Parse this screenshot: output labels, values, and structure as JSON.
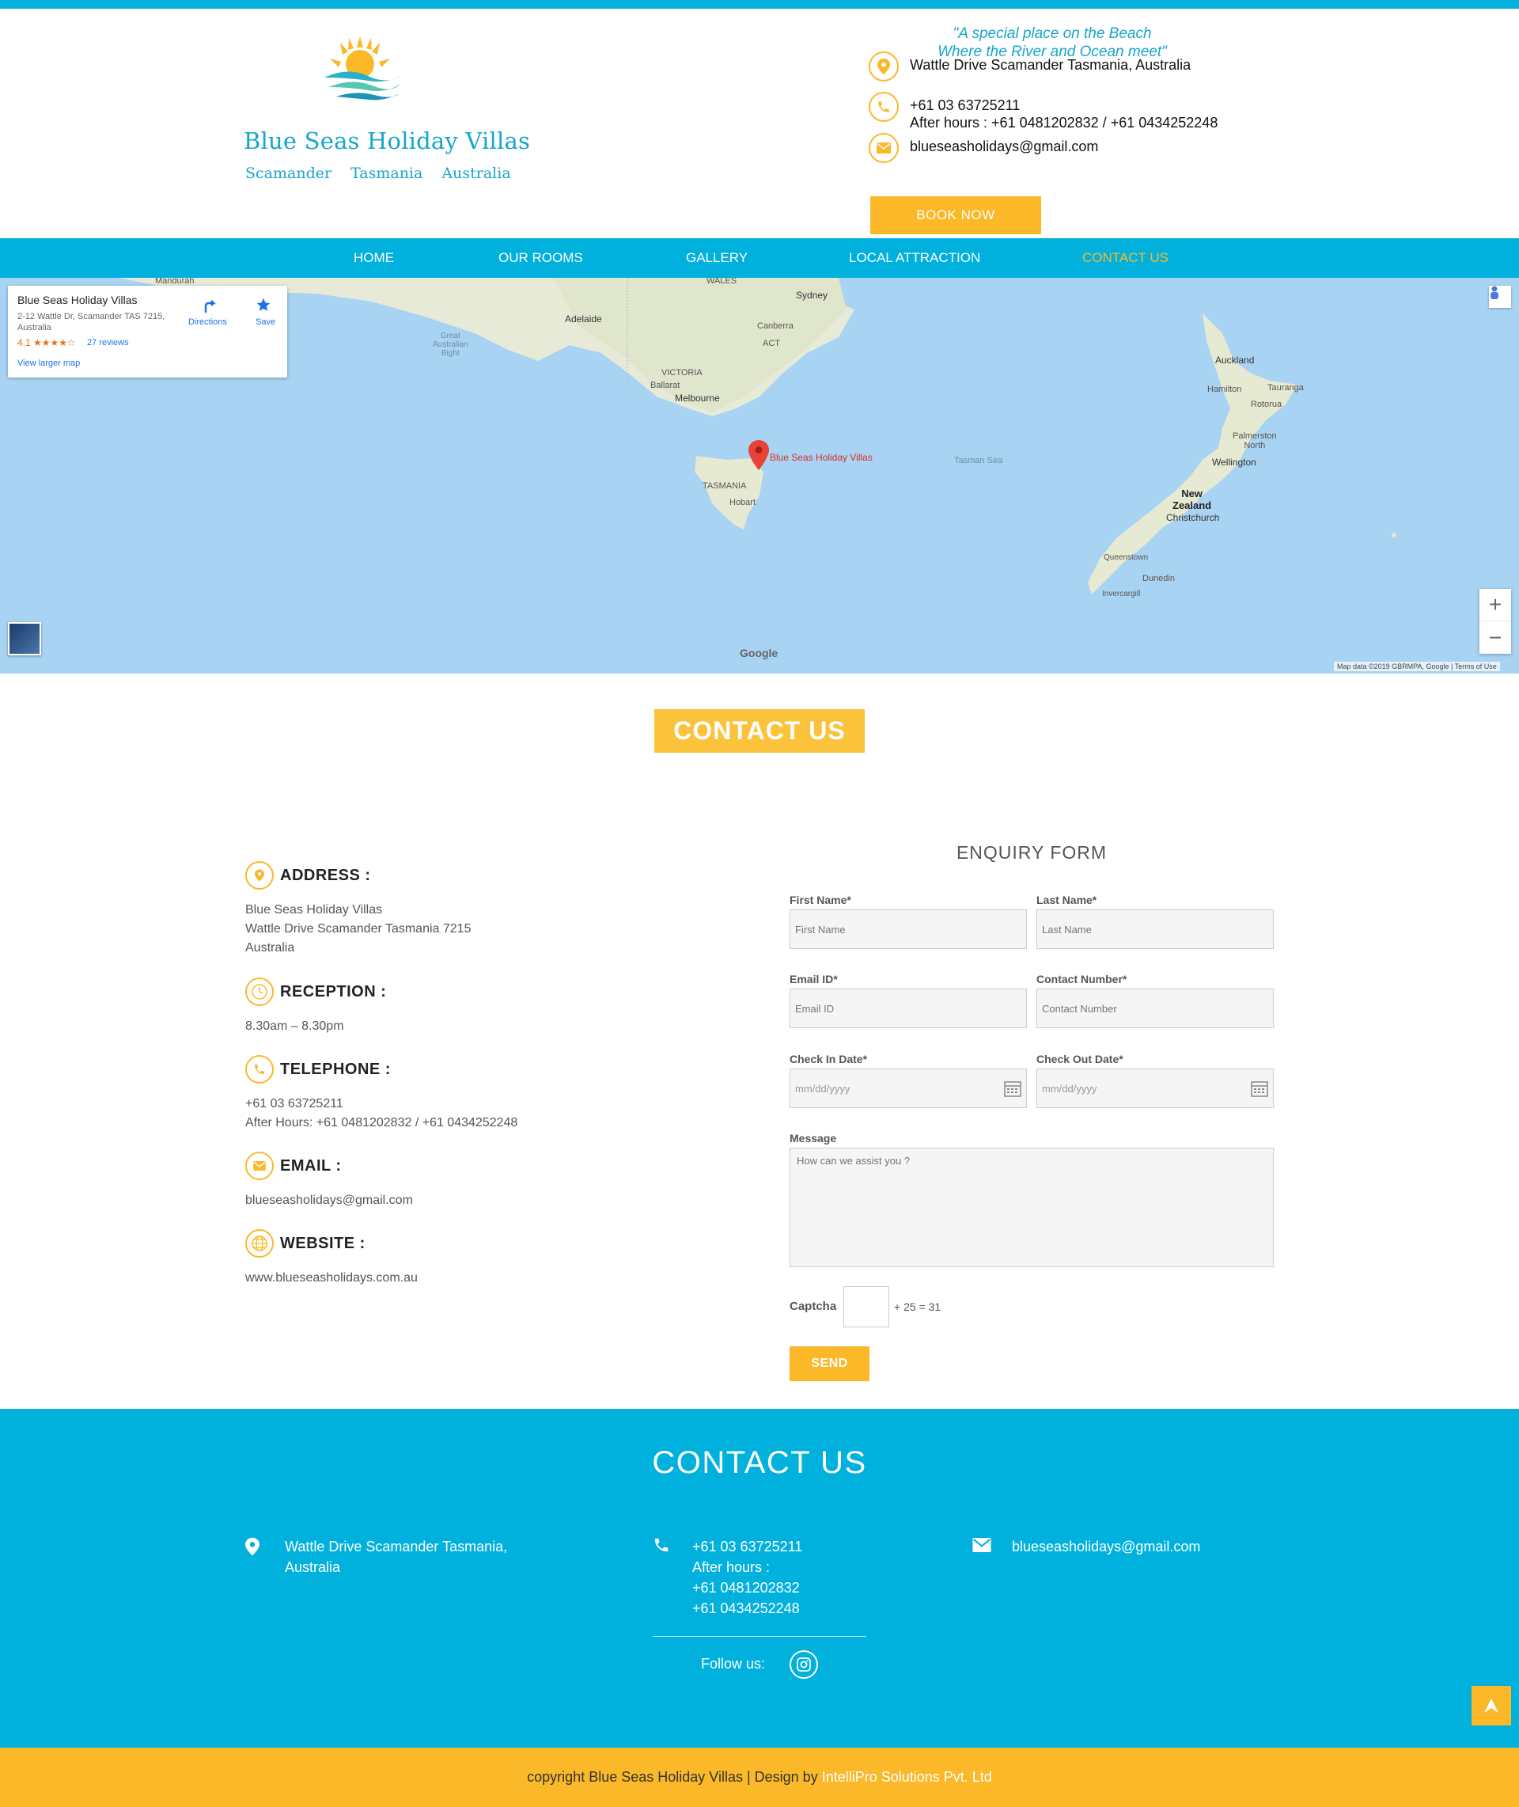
{
  "header": {
    "logo": {
      "title": "Blue Seas Holiday Villas",
      "sub": [
        "Scamander",
        "Tasmania",
        "Australia"
      ]
    },
    "tagline": [
      "\"A special place on the Beach",
      "Where the River and Ocean meet\""
    ],
    "address": "Wattle Drive Scamander Tasmania, Australia",
    "phone": "+61 03 63725211",
    "after_hours": "After hours : +61 0481202832 / +61 0434252248",
    "email": "blueseasholidays@gmail.com",
    "book_now": "BOOK NOW"
  },
  "nav": {
    "items": [
      {
        "label": "HOME"
      },
      {
        "label": "OUR ROOMS"
      },
      {
        "label": "GALLERY"
      },
      {
        "label": "LOCAL ATTRACTION"
      },
      {
        "label": "CONTACT US"
      }
    ],
    "active": "CONTACT US"
  },
  "map": {
    "card": {
      "name": "Blue Seas Holiday Villas",
      "address": "2-12 Wattle Dr, Scamander TAS 7215, Australia",
      "rating": "4.1 ★★★★☆",
      "reviews": "27 reviews",
      "view_larger": "View larger map",
      "directions": "Directions",
      "save": "Save"
    },
    "marker_label": "Blue Seas Holiday Villas",
    "labels": {
      "mandurah": "Mandurah",
      "wales": "WALES",
      "sydney": "Sydney",
      "adelaide": "Adelaide",
      "canberra": "Canberra",
      "act": "ACT",
      "great_bight": [
        "Great",
        "Australian",
        "Bight"
      ],
      "victoria": "VICTORIA",
      "ballarat": "Ballarat",
      "melbourne": "Melbourne",
      "tasmania": "TASMANIA",
      "hobart": "Hobart",
      "tasman_sea": "Tasman Sea",
      "auckland": "Auckland",
      "hamilton": "Hamilton",
      "tauranga": "Tauranga",
      "rotorua": "Rotorua",
      "palmerston": [
        "Palmerston",
        "North"
      ],
      "wellington": "Wellington",
      "new_zealand": [
        "New",
        "Zealand"
      ],
      "christchurch": "Christchurch",
      "queenstown": "Queenstown",
      "dunedin": "Dunedin",
      "invercargill": "Invercargill"
    },
    "google": "Google",
    "attribution": "Map data ©2019 GBRMPA, Google | Terms of Use"
  },
  "contact_section": {
    "title": "CONTACT US",
    "address_head": "ADDRESS :",
    "address_lines": [
      "Blue Seas Holiday Villas",
      "Wattle Drive Scamander Tasmania 7215",
      "Australia"
    ],
    "reception_head": "RECEPTION :",
    "reception": "8.30am – 8.30pm",
    "telephone_head": "TELEPHONE :",
    "telephone_lines": [
      "+61 03 63725211",
      "After Hours: +61 0481202832 / +61 0434252248"
    ],
    "email_head": "EMAIL :",
    "email": "blueseasholidays@gmail.com",
    "website_head": "WEBSITE :",
    "website": "www.blueseasholidays.com.au"
  },
  "form": {
    "title": "ENQUIRY FORM",
    "first_name_label": "First Name*",
    "first_name_placeholder": "First Name",
    "last_name_label": "Last Name*",
    "last_name_placeholder": "Last Name",
    "email_label": "Email ID*",
    "email_placeholder": "Email ID",
    "contact_label": "Contact Number*",
    "contact_placeholder": "Contact Number",
    "checkin_label": "Check In Date*",
    "checkout_label": "Check Out Date*",
    "date_placeholder": "mm/dd/yyyy",
    "message_label": "Message",
    "message_placeholder": "How can we assist you ?",
    "captcha_label": "Captcha",
    "captcha_equation": "+ 25 = 31",
    "send": "SEND"
  },
  "footer": {
    "title": "CONTACT US",
    "address_lines": [
      "Wattle Drive Scamander Tasmania,",
      "Australia"
    ],
    "phone_lines": [
      "+61 03 63725211",
      "After hours :",
      "+61 0481202832",
      "+61 0434252248"
    ],
    "email": "blueseasholidays@gmail.com",
    "follow_us": "Follow us:",
    "copyright": "copyright Blue Seas Holiday Villas | Design by ",
    "designer": "IntelliPro Solutions Pvt. Ltd"
  },
  "colors": {
    "brand_blue": "#00b1de",
    "accent_yellow": "#fbb829"
  }
}
